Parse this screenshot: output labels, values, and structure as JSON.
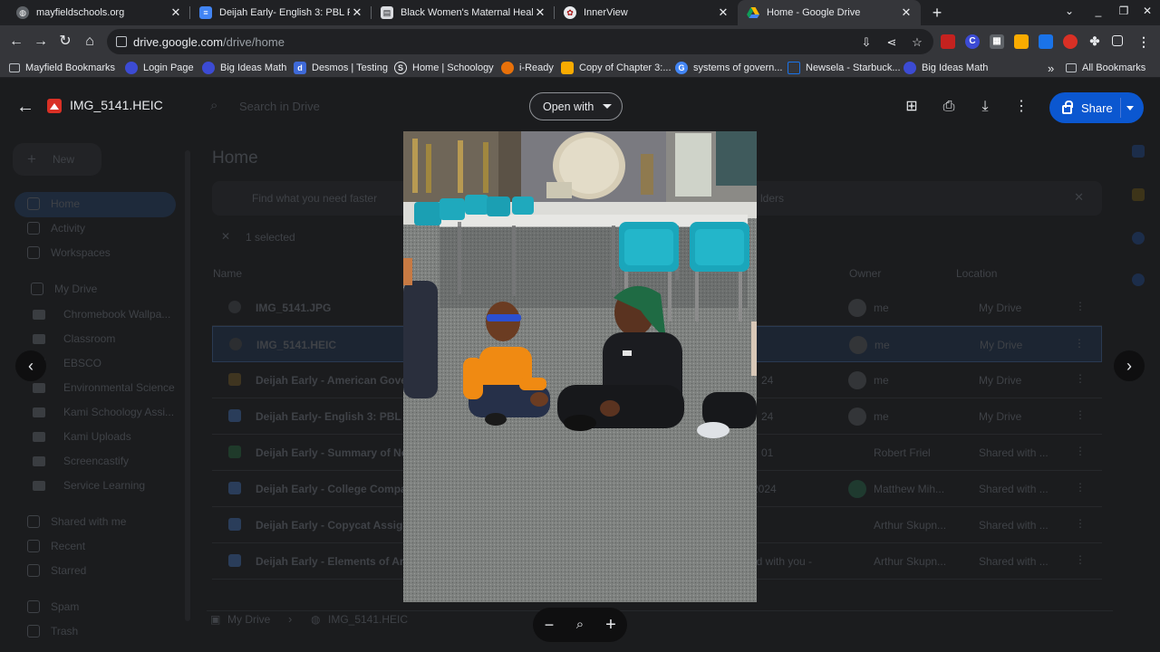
{
  "browser": {
    "tabs": [
      {
        "title": "mayfieldschools.org",
        "icon": "globe-icon"
      },
      {
        "title": "Deijah Early- English 3: PBL Res",
        "icon": "docs-icon"
      },
      {
        "title": "Black Women's Maternal Health",
        "icon": "site-icon"
      },
      {
        "title": "InnerView",
        "icon": "innerview-icon"
      },
      {
        "title": "Home - Google Drive",
        "icon": "drive-icon",
        "active": true
      }
    ],
    "close_glyph": "✕",
    "new_tab_glyph": "+",
    "url_host": "drive.google.com",
    "url_path": "/drive/home"
  },
  "bookmarks": {
    "items": [
      {
        "label": "Mayfield Bookmarks",
        "icon": "folder-icon",
        "color": "#9aa0a6"
      },
      {
        "label": "Login Page",
        "icon": "login-icon",
        "color": "#3c4bd4"
      },
      {
        "label": "Big Ideas Math",
        "icon": "bigideas-icon",
        "color": "#3c4bd4"
      },
      {
        "label": "Desmos | Testing",
        "icon": "desmos-icon",
        "color": "#3f6ad8"
      },
      {
        "label": "Home | Schoology",
        "icon": "schoology-icon",
        "color": "#e8eaed"
      },
      {
        "label": "i-Ready",
        "icon": "iready-icon",
        "color": "#e8710a"
      },
      {
        "label": "Copy of Chapter 3:...",
        "icon": "slides-icon",
        "color": "#f9ab00"
      },
      {
        "label": "systems of govern...",
        "icon": "google-icon",
        "color": "#4285f4"
      },
      {
        "label": "Newsela - Starbuck...",
        "icon": "newsela-icon",
        "color": "#1a73e8"
      },
      {
        "label": "Big Ideas Math",
        "icon": "bigideas-icon",
        "color": "#3c4bd4"
      }
    ],
    "overflow": "»",
    "all_bookmarks": "All Bookmarks"
  },
  "drive": {
    "search_placeholder": "Search in Drive",
    "new_label": "New",
    "page_title": "Home",
    "banner_text": "Find what you need faster",
    "banner_suffix": "lders",
    "selected_text": "1 selected",
    "col_name": "Name",
    "col_owner": "Owner",
    "col_location": "Location",
    "nav": [
      {
        "label": "Home"
      },
      {
        "label": "Activity"
      },
      {
        "label": "Workspaces"
      },
      {
        "label": "My Drive"
      }
    ],
    "folders": [
      "Chromebook Wallpa...",
      "Classroom",
      "EBSCO",
      "Environmental Science",
      "Kami Schoology Assi...",
      "Kami Uploads",
      "Screencastify",
      "Service Learning"
    ],
    "nav2": [
      "Shared with me",
      "Recent",
      "Starred",
      "Spam",
      "Trash"
    ],
    "files": [
      {
        "name": "IMG_5141.JPG",
        "owner": "me",
        "location": "My Drive",
        "date": ""
      },
      {
        "name": "IMG_5141.HEIC",
        "owner": "me",
        "location": "My Drive",
        "date": "",
        "selected": true
      },
      {
        "name": "Deijah Early - American Gove",
        "owner": "me",
        "location": "My Drive",
        "date": "24"
      },
      {
        "name": "Deijah Early- English 3: PBL R",
        "owner": "me",
        "location": "My Drive",
        "date": "24"
      },
      {
        "name": "Deijah Early - Summary of No",
        "owner": "Robert Friel",
        "location": "Shared with ...",
        "date": "01"
      },
      {
        "name": "Deijah Early - College Compa",
        "owner": "Matthew Mih...",
        "location": "Shared with ...",
        "date": "2024"
      },
      {
        "name": "Deijah Early - Copycat Assign",
        "owner": "Arthur Skupn...",
        "location": "Shared with ...",
        "date": ""
      },
      {
        "name": "Deijah Early - Elements of Ar",
        "owner": "Arthur Skupn...",
        "location": "Shared with ...",
        "date": "red with you -"
      }
    ],
    "breadcrumb_root": "My Drive",
    "breadcrumb_file": "IMG_5141.HEIC"
  },
  "viewer": {
    "file_name": "IMG_5141.HEIC",
    "open_with": "Open with",
    "share": "Share",
    "prev_glyph": "‹",
    "next_glyph": "›",
    "zoom_out": "−",
    "zoom_in": "+"
  }
}
